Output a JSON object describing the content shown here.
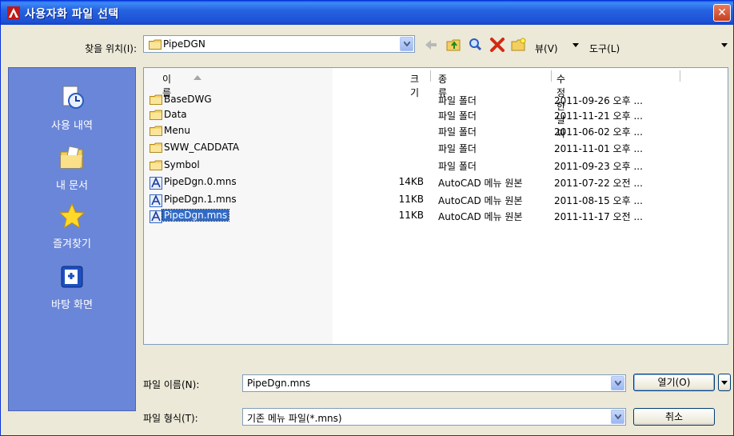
{
  "window": {
    "title": "사용자화 파일 선택",
    "close_label": "✕"
  },
  "toolbar": {
    "look_in_label": "찾을 위치(I):",
    "look_in_value": "PipeDGN",
    "view_label": "뷰(V)",
    "tools_label": "도구(L)"
  },
  "places": [
    {
      "label": "사용 내역",
      "icon": "history-icon"
    },
    {
      "label": "내 문서",
      "icon": "my-documents-icon"
    },
    {
      "label": "즐겨찾기",
      "icon": "favorites-star-icon"
    },
    {
      "label": "바탕 화면",
      "icon": "desktop-icon"
    }
  ],
  "columns": {
    "name": "이름",
    "size": "크기",
    "type": "종류",
    "modified": "수정한 날짜"
  },
  "files": [
    {
      "name": "BaseDWG",
      "size": "",
      "type": "파일 폴더",
      "modified": "2011-09-26 오후 ...",
      "icon": "folder-icon"
    },
    {
      "name": "Data",
      "size": "",
      "type": "파일 폴더",
      "modified": "2011-11-21 오후 ...",
      "icon": "folder-icon"
    },
    {
      "name": "Menu",
      "size": "",
      "type": "파일 폴더",
      "modified": "2011-06-02 오후 ...",
      "icon": "folder-icon"
    },
    {
      "name": "SWW_CADDATA",
      "size": "",
      "type": "파일 폴더",
      "modified": "2011-11-01 오후 ...",
      "icon": "folder-icon"
    },
    {
      "name": "Symbol",
      "size": "",
      "type": "파일 폴더",
      "modified": "2011-09-23 오후 ...",
      "icon": "folder-icon"
    },
    {
      "name": "PipeDgn.0.mns",
      "size": "14KB",
      "type": "AutoCAD 메뉴 원본",
      "modified": "2011-07-22 오전 ...",
      "icon": "autocad-file-icon"
    },
    {
      "name": "PipeDgn.1.mns",
      "size": "11KB",
      "type": "AutoCAD 메뉴 원본",
      "modified": "2011-08-15 오후 ...",
      "icon": "autocad-file-icon"
    },
    {
      "name": "PipeDgn.mns",
      "size": "11KB",
      "type": "AutoCAD 메뉴 원본",
      "modified": "2011-11-17 오전 ...",
      "icon": "autocad-file-icon",
      "selected": true
    }
  ],
  "footer": {
    "filename_label": "파일 이름(N):",
    "filename_value": "PipeDgn.mns",
    "filetype_label": "파일 형식(T):",
    "filetype_value": "기존 메뉴 파일(*.mns)",
    "open_label": "열기(O)",
    "cancel_label": "취소"
  },
  "colors": {
    "titlebar": "#2563e0",
    "places_panel": "#6a86d8",
    "selection": "#316ac5"
  }
}
